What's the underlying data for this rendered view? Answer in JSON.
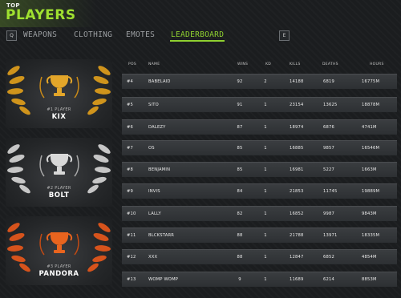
{
  "header": {
    "top_label": "TOP",
    "title": "PLAYERS"
  },
  "nav": {
    "left_key": "Q",
    "right_key": "E",
    "tabs": [
      {
        "label": "WEAPONS"
      },
      {
        "label": "CLOTHING"
      },
      {
        "label": "EMOTES"
      },
      {
        "label": "LEADERBOARD",
        "active": true
      }
    ]
  },
  "podium": [
    {
      "rank_label": "#1 PLAYER",
      "name": "KIX",
      "color": "#e8a020"
    },
    {
      "rank_label": "#2 PLAYER",
      "name": "BOLT",
      "color": "#c8c8c8"
    },
    {
      "rank_label": "#3 PLAYER",
      "name": "PANDORA",
      "color": "#e85a20"
    }
  ],
  "table": {
    "columns": [
      "POS",
      "NAME",
      "WINS",
      "KD",
      "KILLS",
      "DEATHS",
      "HOURS"
    ],
    "rows": [
      {
        "pos": "#4",
        "name": "BABELAID",
        "wins": "92",
        "kd": "2",
        "kills": "14188",
        "deaths": "6819",
        "hours": "16775M"
      },
      {
        "pos": "#5",
        "name": "SITO",
        "wins": "91",
        "kd": "1",
        "kills": "23154",
        "deaths": "13625",
        "hours": "18878M"
      },
      {
        "pos": "#6",
        "name": "DALEZY",
        "wins": "87",
        "kd": "1",
        "kills": "18974",
        "deaths": "6876",
        "hours": "4741M"
      },
      {
        "pos": "#7",
        "name": "OS",
        "wins": "85",
        "kd": "1",
        "kills": "16885",
        "deaths": "9857",
        "hours": "16546M"
      },
      {
        "pos": "#8",
        "name": "BENJAMIN",
        "wins": "85",
        "kd": "1",
        "kills": "16981",
        "deaths": "5227",
        "hours": "1663M"
      },
      {
        "pos": "#9",
        "name": "INVIS",
        "wins": "84",
        "kd": "1",
        "kills": "21853",
        "deaths": "11745",
        "hours": "19889M"
      },
      {
        "pos": "#10",
        "name": "LALLY",
        "wins": "82",
        "kd": "1",
        "kills": "16852",
        "deaths": "9987",
        "hours": "9843M"
      },
      {
        "pos": "#11",
        "name": "BLCKSTARR",
        "wins": "88",
        "kd": "1",
        "kills": "21788",
        "deaths": "13971",
        "hours": "18335M"
      },
      {
        "pos": "#12",
        "name": "XXX",
        "wins": "88",
        "kd": "1",
        "kills": "12847",
        "deaths": "6852",
        "hours": "4854M"
      },
      {
        "pos": "#13",
        "name": "WOMP WOMP",
        "wins": "9",
        "kd": "1",
        "kills": "11689",
        "deaths": "6214",
        "hours": "8853M"
      }
    ]
  }
}
